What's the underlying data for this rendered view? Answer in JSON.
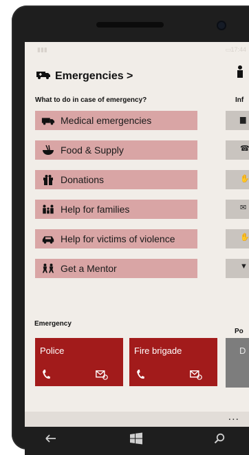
{
  "status_bar": {
    "time": "17:44"
  },
  "main_panel": {
    "title": "Emergencies >",
    "subtitle": "What to do in case of emergency?",
    "items": [
      {
        "label": "Medical emergencies",
        "icon": "ambulance-icon"
      },
      {
        "label": "Food & Supply",
        "icon": "food-bowl-icon"
      },
      {
        "label": "Donations",
        "icon": "gift-icon"
      },
      {
        "label": "Help for families",
        "icon": "family-icon"
      },
      {
        "label": "Help for victims of violence",
        "icon": "car-icon"
      },
      {
        "label": "Get a Mentor",
        "icon": "mentor-icon"
      }
    ],
    "emergency_label": "Emergency",
    "tiles": [
      {
        "label": "Police",
        "call_icon": "phone-icon",
        "mail_icon": "email-icon"
      },
      {
        "label": "Fire brigade",
        "call_icon": "phone-icon",
        "mail_icon": "email-icon"
      }
    ]
  },
  "side_panel": {
    "subtitle": "Inf",
    "second_label": "Po",
    "tile_letter": "D",
    "item_icons": [
      "building-icon",
      "phone-icon",
      "hand-icon",
      "email-icon",
      "hand-icon",
      "tool-icon"
    ]
  },
  "app_bar": {
    "more_label": "..."
  },
  "colors": {
    "menu_item_bg": "#d9a5a5",
    "tile_bg": "#a21b1b",
    "screen_bg": "#f1ede8",
    "phone_body": "#1e1e1e"
  }
}
